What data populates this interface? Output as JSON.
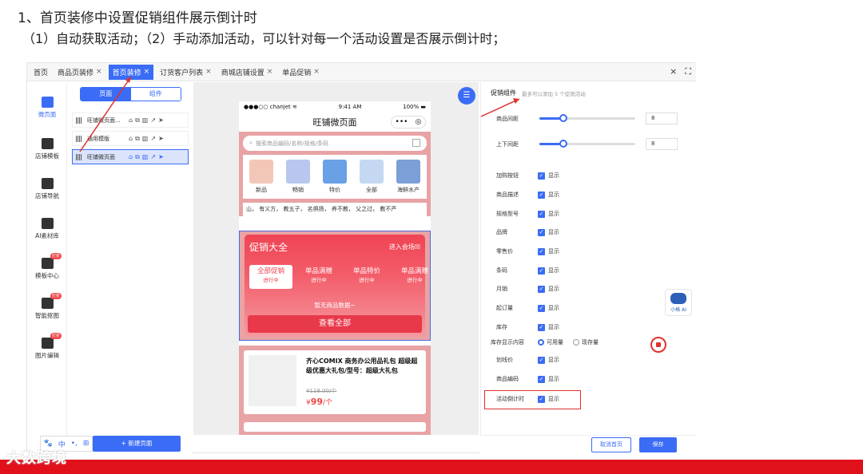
{
  "slide": {
    "title": "1、首页装修中设置促销组件展示倒计时",
    "subtitle": "（1）自动获取活动；（2）手动添加活动，可以针对每一个活动设置是否展示倒计时；"
  },
  "tabs": [
    {
      "label": "首页",
      "close": ""
    },
    {
      "label": "商品页装修",
      "close": "×"
    },
    {
      "label": "首页装修",
      "close": "×",
      "active": true
    },
    {
      "label": "订货客户列表",
      "close": "×"
    },
    {
      "label": "商城店铺设置",
      "close": "×"
    },
    {
      "label": "单品促销",
      "close": "×"
    }
  ],
  "tabbar_actions": {
    "close": "×",
    "fullscreen": "⛶"
  },
  "leftnav": [
    {
      "label": "微页面",
      "badge": ""
    },
    {
      "label": "店铺模板",
      "badge": ""
    },
    {
      "label": "店铺导航",
      "badge": ""
    },
    {
      "label": "AI素材库",
      "badge": ""
    },
    {
      "label": "模板中心",
      "badge": "打折"
    },
    {
      "label": "智能抠图",
      "badge": "打折"
    },
    {
      "label": "图片编辑",
      "badge": "打折"
    }
  ],
  "pagepanel": {
    "seg_pages": "页面",
    "seg_components": "组件",
    "rows": [
      "旺铺微页面...",
      "通用模版",
      "旺铺微页面"
    ],
    "tools": [
      "🐾",
      "中",
      "•,",
      "⊞"
    ],
    "new_page": "+ 新建页面"
  },
  "phone": {
    "carrier": "●●●○○ chanjet ≋",
    "time": "9:41 AM",
    "battery": "100% ▬",
    "title": "旺铺微页面",
    "capsule_more": "•••",
    "capsule_close": "◎",
    "search_placeholder": "搜索商品编码/名称/规格/条码",
    "categories": [
      "新品",
      "畅销",
      "特价",
      "全部",
      "海鲜水产"
    ],
    "notice": "山， 有义方， 教五子， 名俱扬， 养不教， 父之过， 教不严",
    "promo": {
      "title": "促销大全",
      "enter": "进入会场☒",
      "tabs": [
        {
          "name": "全部促销",
          "status": "进行中"
        },
        {
          "name": "单品满赠",
          "status": "进行中"
        },
        {
          "name": "单品特价",
          "status": "进行中"
        },
        {
          "name": "单品满赠",
          "status": "进行中"
        }
      ],
      "empty": "暂无商品数据~",
      "view_all": "查看全部"
    },
    "product": {
      "title": "齐心COMIX 商务办公用品礼包 超级超级优惠大礼包/型号：超级大礼包",
      "old_price": "¥119.00/个",
      "price_symbol": "¥",
      "price": "99",
      "price_unit": "/个"
    }
  },
  "fab": "☰",
  "settings": {
    "title": "促销组件",
    "note": "最多可以添加 5 个促销活动",
    "sliders": [
      {
        "label": "商品间距",
        "value": "8",
        "level": 0.25
      },
      {
        "label": "上下间距",
        "value": "8",
        "level": 0.25
      }
    ],
    "options": [
      {
        "label": "加购按钮",
        "text": "显示"
      },
      {
        "label": "商品描述",
        "text": "显示"
      },
      {
        "label": "规格型号",
        "text": "显示"
      },
      {
        "label": "品牌",
        "text": "显示"
      },
      {
        "label": "零售价",
        "text": "显示"
      },
      {
        "label": "条码",
        "text": "显示"
      },
      {
        "label": "月销",
        "text": "显示"
      },
      {
        "label": "起订量",
        "text": "显示"
      },
      {
        "label": "库存",
        "text": "显示"
      }
    ],
    "stock_display": {
      "label": "库存显示内容",
      "opt1": "可用量",
      "opt2": "现存量"
    },
    "options2": [
      {
        "label": "划线价",
        "text": "显示"
      },
      {
        "label": "商品编码",
        "text": "显示"
      },
      {
        "label": "活动倒计时",
        "text": "显示"
      }
    ],
    "check": "✓",
    "cancel": "取消首页",
    "save": "保存"
  },
  "ai_widget": {
    "label": "小格 AI"
  },
  "brand": "大数跨境",
  "colors": {
    "accent": "#3b6cf6",
    "promo": "#ef4454",
    "highlight": "#e03030",
    "footer": "#e0111b"
  }
}
